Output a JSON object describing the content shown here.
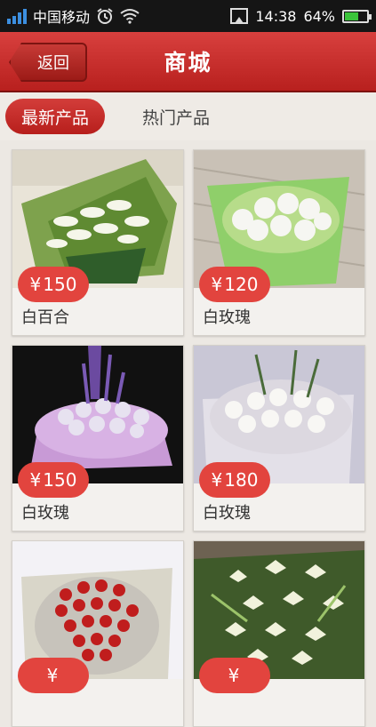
{
  "status": {
    "carrier": "中国移动",
    "time": "14:38",
    "battery": "64%",
    "battery_level": 0.64
  },
  "header": {
    "back_label": "返回",
    "title": "商城"
  },
  "tabs": [
    {
      "label": "最新产品",
      "active": true
    },
    {
      "label": "热门产品",
      "active": false
    }
  ],
  "products": [
    {
      "currency": "¥",
      "price": "150",
      "name": "白百合"
    },
    {
      "currency": "¥",
      "price": "120",
      "name": "白玫瑰"
    },
    {
      "currency": "¥",
      "price": "150",
      "name": "白玫瑰"
    },
    {
      "currency": "¥",
      "price": "180",
      "name": "白玫瑰"
    },
    {
      "currency": "¥",
      "price": "",
      "name": ""
    },
    {
      "currency": "¥",
      "price": "",
      "name": ""
    }
  ],
  "colors": {
    "accent_red": "#c52a27",
    "price_red": "#e2443e"
  }
}
